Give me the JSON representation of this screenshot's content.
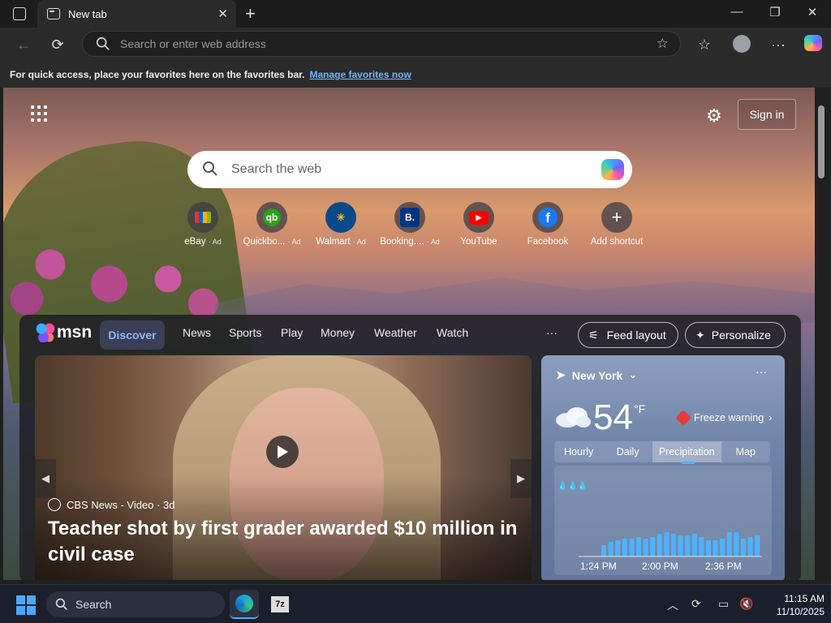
{
  "browser": {
    "tab_title": "New tab",
    "address_placeholder": "Search or enter web address"
  },
  "favbar": {
    "text": "For quick access, place your favorites here on the favorites bar.",
    "link": "Manage favorites now"
  },
  "newtab": {
    "signin": "Sign in",
    "search_placeholder": "Search the web",
    "shortcuts": [
      {
        "label": "eBay",
        "ad": "· Ad",
        "icon_text": "",
        "color": "#2b2b35"
      },
      {
        "label": "Quickbo...",
        "ad": "· Ad",
        "icon_text": "qb",
        "color": "#2ca01c"
      },
      {
        "label": "Walmart",
        "ad": "· Ad",
        "icon_text": "✳",
        "color": "#0071ce"
      },
      {
        "label": "Booking....",
        "ad": "· Ad",
        "icon_text": "B.",
        "color": "#003580"
      },
      {
        "label": "YouTube",
        "ad": "",
        "icon_text": "▶",
        "color": "#ff0000"
      },
      {
        "label": "Facebook",
        "ad": "",
        "icon_text": "f",
        "color": "#1877f2"
      },
      {
        "label": "Add shortcut",
        "ad": "",
        "icon_text": "+",
        "color": "#555"
      }
    ]
  },
  "msn": {
    "logo": "msn",
    "nav": [
      "Discover",
      "News",
      "Sports",
      "Play",
      "Money",
      "Weather",
      "Watch"
    ],
    "more": "···",
    "feed_layout": "Feed layout",
    "personalize": "Personalize",
    "hero": {
      "source": "CBS News - Video · 3d",
      "headline": "Teacher shot by first grader awarded $10 million in civil case"
    },
    "weather": {
      "location": "New York",
      "temp": "54",
      "unit": "°F",
      "alert": "Freeze warning",
      "tabs": [
        "Hourly",
        "Daily",
        "Precipitation",
        "Map"
      ],
      "times": [
        "1:24 PM",
        "2:00 PM",
        "2:36 PM"
      ]
    }
  },
  "taskbar": {
    "search": "Search",
    "time": "11:15 AM",
    "date": "11/10/2025"
  }
}
